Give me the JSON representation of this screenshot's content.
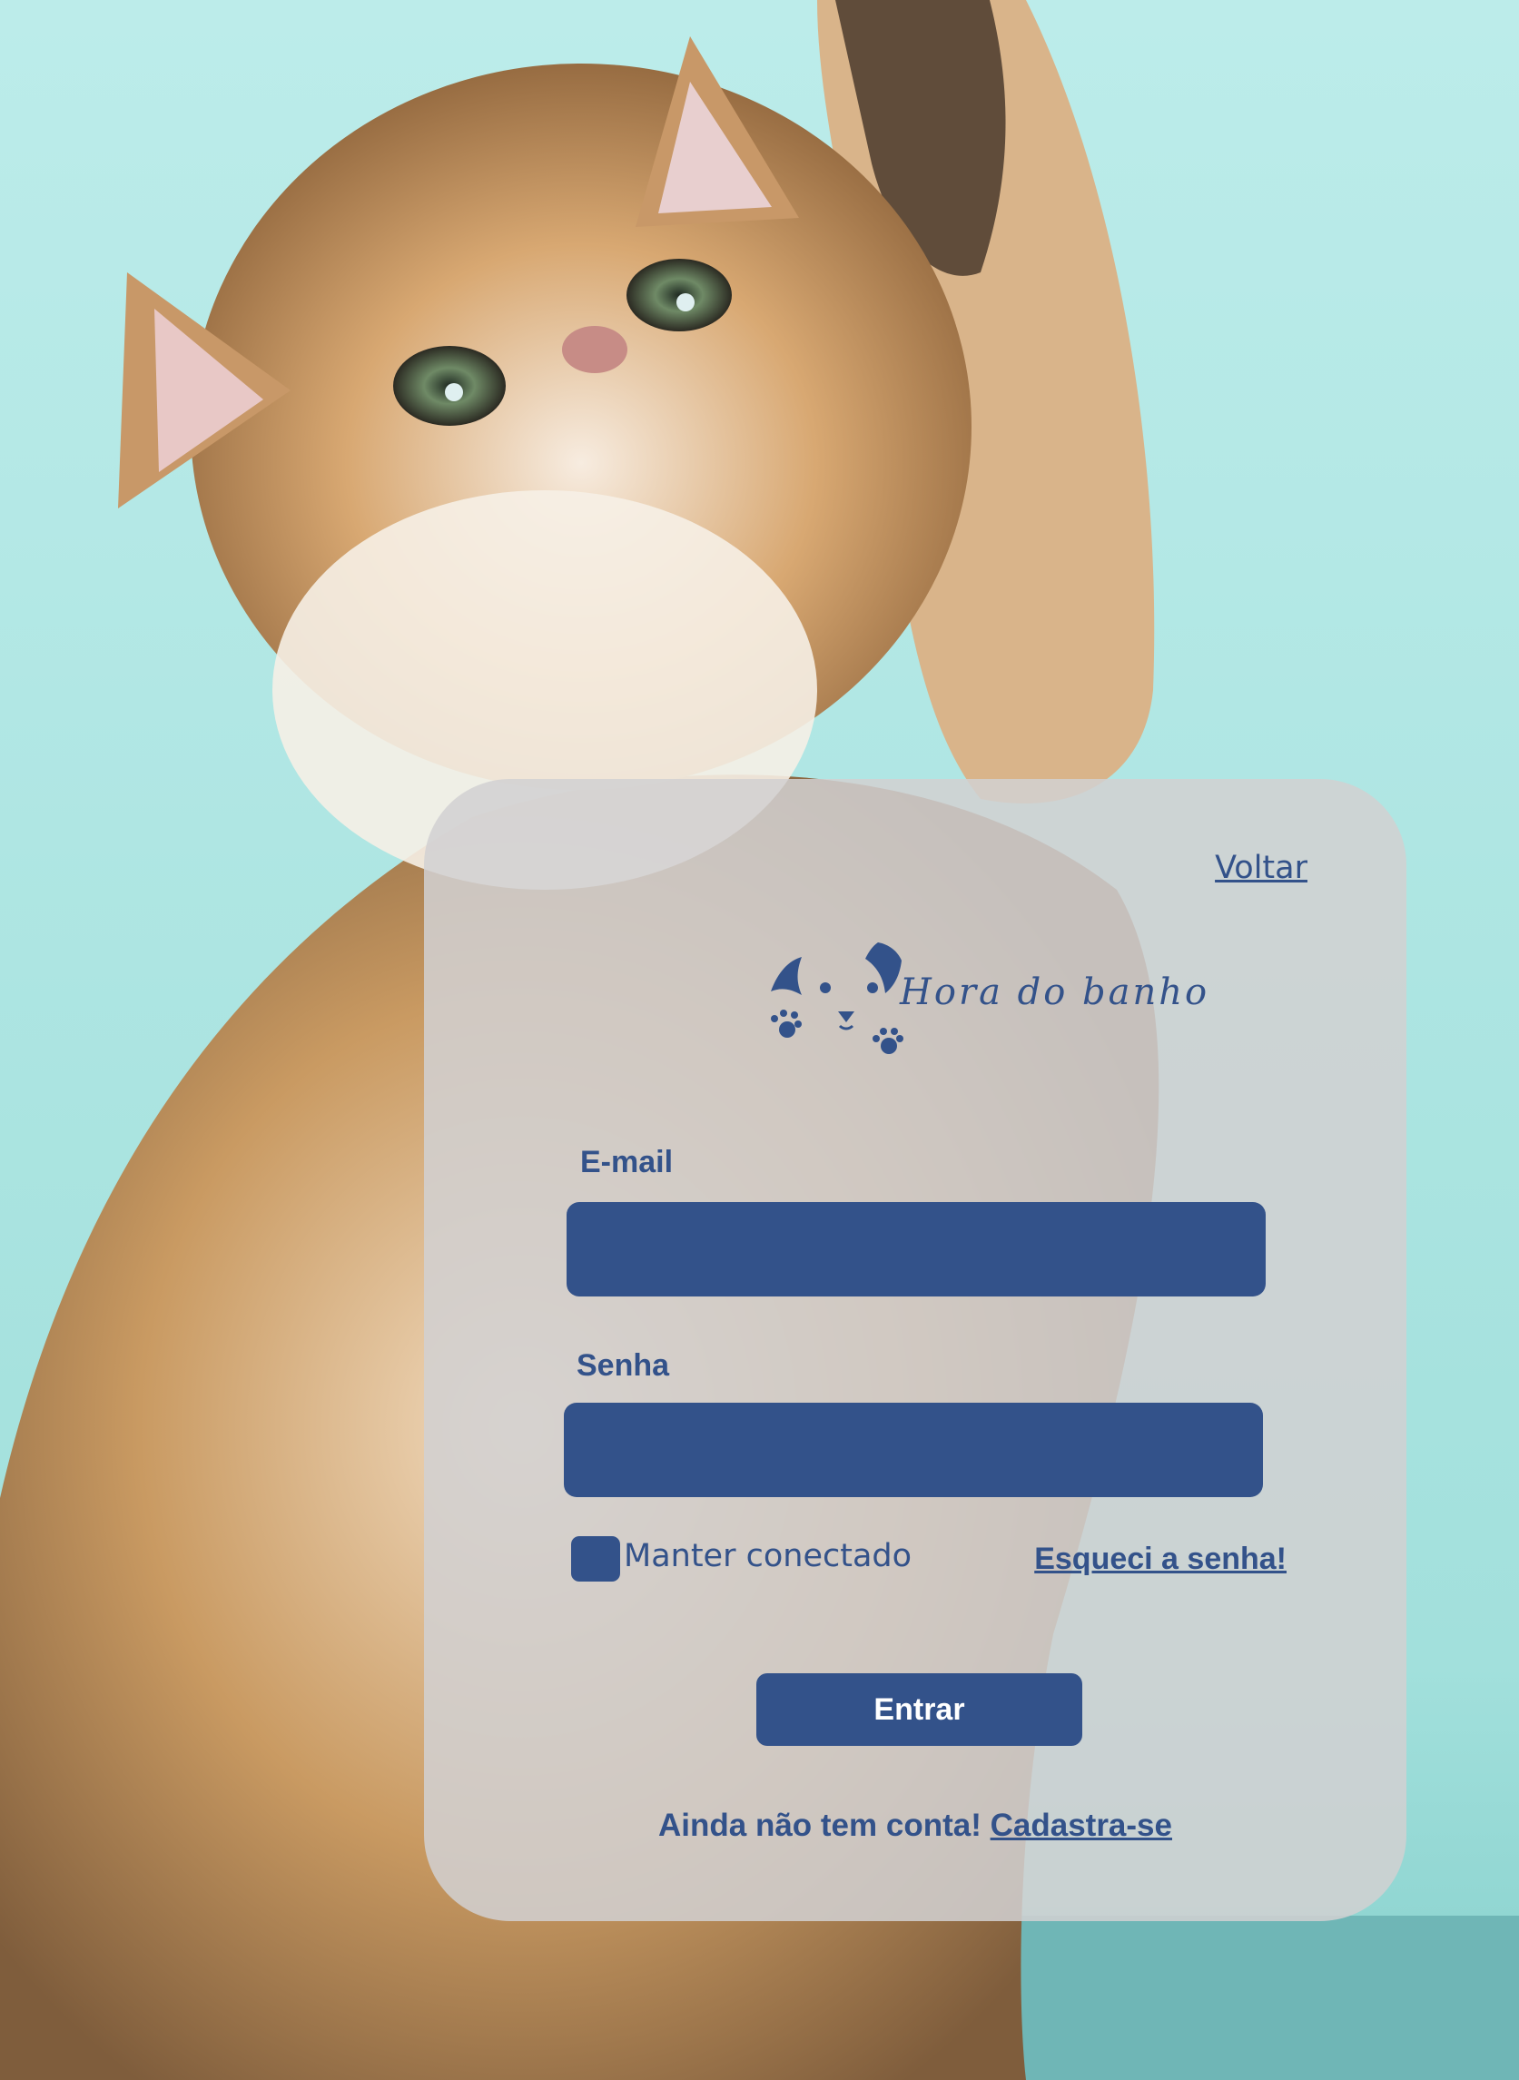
{
  "theme": {
    "accent": "#33528a",
    "card_background": "#d2d0d2",
    "page_background": "#b4e6e4",
    "button_text": "#ffffff"
  },
  "background": {
    "image": "kitten-photo"
  },
  "nav": {
    "back_label": "Voltar"
  },
  "logo": {
    "icon": "cat-face-with-paws-icon",
    "text": "Hora do banho"
  },
  "form": {
    "email_label": "E-mail",
    "email_value": "",
    "password_label": "Senha",
    "password_value": "",
    "remember_label": "Manter conectado",
    "remember_checked": false,
    "forgot_label": "Esqueci a senha!",
    "submit_label": "Entrar"
  },
  "signup": {
    "prompt": "Ainda não tem conta!",
    "link_label": "Cadastra-se"
  }
}
